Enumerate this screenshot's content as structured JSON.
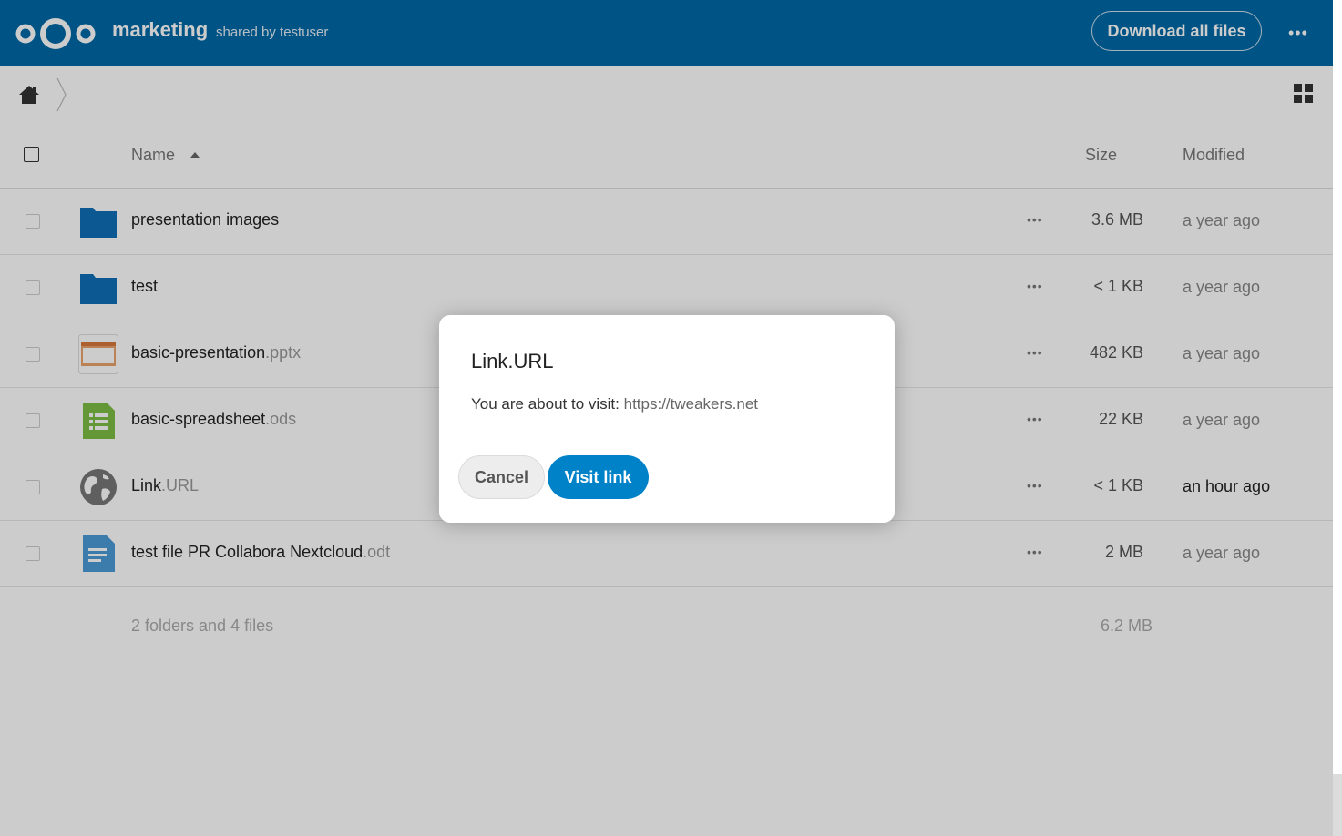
{
  "header": {
    "app_name": "marketing",
    "shared_by": "shared by testuser",
    "download_all": "Download all files",
    "more": "•••",
    "brand_color": "#0069a7"
  },
  "list": {
    "columns": {
      "name": "Name",
      "size": "Size",
      "modified": "Modified"
    },
    "rows": [
      {
        "base": "presentation images",
        "ext": "",
        "icon": "folder-icon",
        "size": "3.6 MB",
        "modified": "a year ago"
      },
      {
        "base": "test",
        "ext": "",
        "icon": "folder-icon",
        "size": "< 1 KB",
        "modified": "a year ago"
      },
      {
        "base": "basic-presentation",
        "ext": ".pptx",
        "icon": "presentation-file-icon",
        "size": "482 KB",
        "modified": "a year ago"
      },
      {
        "base": "basic-spreadsheet",
        "ext": ".ods",
        "icon": "spreadsheet-file-icon",
        "size": "22 KB",
        "modified": "a year ago"
      },
      {
        "base": "Link",
        "ext": ".URL",
        "icon": "globe-link-icon",
        "size": "< 1 KB",
        "modified": "an hour ago"
      },
      {
        "base": "test file PR Collabora Nextcloud",
        "ext": ".odt",
        "icon": "document-file-icon",
        "size": "2 MB",
        "modified": "a year ago"
      }
    ],
    "more": "•••",
    "summary": "2 folders and 4 files",
    "summary_size": "6.2 MB"
  },
  "dialog": {
    "title": "Link.URL",
    "message": "You are about to visit:",
    "url": "https://tweakers.net",
    "cancel": "Cancel",
    "visit": "Visit link",
    "primary_color": "#0082c9"
  }
}
